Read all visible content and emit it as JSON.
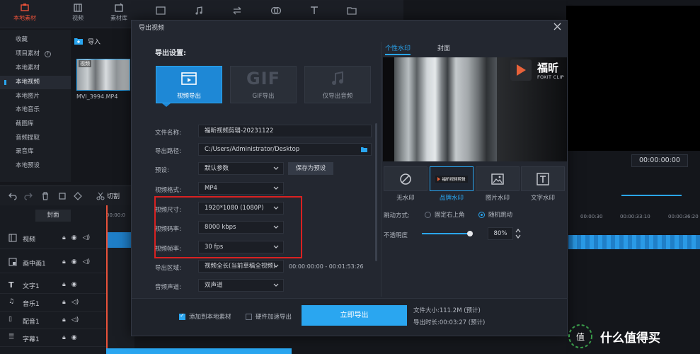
{
  "app": {
    "toolbar": [
      {
        "label": "本地素材",
        "icon": "folder-icon"
      },
      {
        "label": "视频",
        "icon": "film-icon"
      },
      {
        "label": "素材库",
        "icon": "library-icon"
      }
    ],
    "nav": [
      "收藏",
      "项目素材",
      "本地素材",
      "本地视频",
      "本地图片",
      "本地音乐",
      "截图库",
      "音频提取",
      "录音库",
      "本地预设"
    ],
    "nav_active": 3,
    "import_label": "导入",
    "clip_badge": "视频",
    "clip_name": "MVI_3994.MP4",
    "edit_split": "切割",
    "tracks_header": "封面",
    "tracks": [
      "视频",
      "画中画1",
      "文字1",
      "音乐1",
      "配音1",
      "字幕1"
    ],
    "preview_time": "00:00:00:00",
    "ruler": [
      "00:00:30",
      "00:00:33:10",
      "00:00:36:20"
    ],
    "ruler_left": "00:00:0"
  },
  "dialog": {
    "title": "导出视频",
    "settings_title": "导出设置:",
    "modes": [
      {
        "label": "视频导出",
        "active": true
      },
      {
        "label": "GIF导出",
        "active": false,
        "glyph": "GIF"
      },
      {
        "label": "仅导出音频",
        "active": false
      }
    ],
    "rows": {
      "filename_label": "文件名称:",
      "filename": "福昕视频剪辑-20231122",
      "path_label": "导出路径:",
      "path": "C:/Users/Administrator/Desktop",
      "preset_label": "预设:",
      "preset": "默认参数",
      "save_preset": "保存为预设",
      "format_label": "视频格式:",
      "format": "MP4",
      "resolution_label": "视频尺寸:",
      "resolution": "1920*1080 (1080P)",
      "bitrate_label": "视频码率:",
      "bitrate": "8000 kbps",
      "fps_label": "视频帧率:",
      "fps": "30 fps",
      "range_label": "导出区域:",
      "range": "视频全长(当前草稿全视频)",
      "range_time": "00:00:00:00 - 00:01:53:26",
      "channel_label": "音频声道:",
      "channel": "双声道"
    },
    "right_tabs": [
      {
        "label": "个性水印",
        "active": true
      },
      {
        "label": "封面",
        "active": false
      }
    ],
    "preview_watermark": {
      "name": "福昕",
      "sub": "FOXIT CLIP"
    },
    "watermark_options": [
      {
        "label": "无水印",
        "icon": "none-icon"
      },
      {
        "label": "品牌水印",
        "icon": "brand-watermark-icon",
        "text": "福昕视频剪辑"
      },
      {
        "label": "图片水印",
        "icon": "image-icon"
      },
      {
        "label": "文字水印",
        "icon": "text-icon"
      }
    ],
    "watermark_active": 1,
    "motion_label": "跳动方式:",
    "motion_options": [
      {
        "label": "固定右上角",
        "checked": false
      },
      {
        "label": "随机跳动",
        "checked": true
      }
    ],
    "opacity_label": "不透明度",
    "opacity_value": "80%",
    "opacity_fraction": 0.8,
    "footer": {
      "add_local": "添加到本地素材",
      "add_local_checked": true,
      "hw_accel": "硬件加速导出",
      "hw_accel_checked": false,
      "export_now": "立即导出",
      "file_size": "文件大小:111.2M (预计)",
      "duration": "导出时长:00:03:27 (预计)"
    }
  },
  "site_watermark": "什么值得买",
  "colors": {
    "accent": "#2aa6f0",
    "highlight": "#d92121",
    "brand": "#e8523a"
  }
}
